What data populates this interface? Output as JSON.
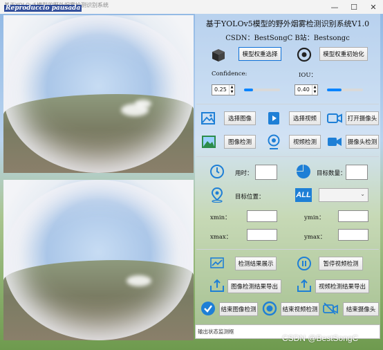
{
  "window": {
    "title": "基于YOLOv5模型的野外烟雾检测识别系统",
    "overlay": "Reproduccio pausada",
    "controls": {
      "minimize": "—",
      "maximize": "☐",
      "close": "✕"
    }
  },
  "header": {
    "title": "基于YOLOv5模型的野外烟雾检测识别系统V1.0",
    "subtitle": "CSDN：BestSongC   B站：Bestsongc"
  },
  "model": {
    "select_label": "模型权重选择",
    "init_label": "模型权重初始化"
  },
  "params": {
    "confidence_label": "Confidence:",
    "confidence_value": "0.25",
    "confidence_fraction": 0.25,
    "iou_label": "IOU：",
    "iou_value": "0.40",
    "iou_fraction": 0.4
  },
  "inputs": {
    "select_image": "选择图像",
    "select_video": "选择视频",
    "open_camera": "打开摄像头",
    "image_detect": "图像检测",
    "video_detect": "视频检测",
    "camera_detect": "摄像头检测"
  },
  "stats": {
    "time_label": "用时：",
    "count_label": "目标数量：",
    "position_label": "目标位置：",
    "all_label": "ALL",
    "xmin_label": "xmin：",
    "ymin_label": "ymin：",
    "xmax_label": "xmax：",
    "ymax_label": "ymax："
  },
  "actions": {
    "show_results": "检测结果展示",
    "pause_video": "暂停视频检测",
    "export_image": "图像检测结果导出",
    "export_video": "视频检测结果导出",
    "end_image": "结束图像检测",
    "end_video": "结束视频检测",
    "end_camera": "结束摄像头"
  },
  "status_bar": {
    "text": "输出状态监测框"
  },
  "watermark": "CSDN @BestSongC",
  "colors": {
    "accent": "#0a84ff",
    "icon_blue": "#1e7fd6",
    "titlebar": "#f3f3f3"
  }
}
